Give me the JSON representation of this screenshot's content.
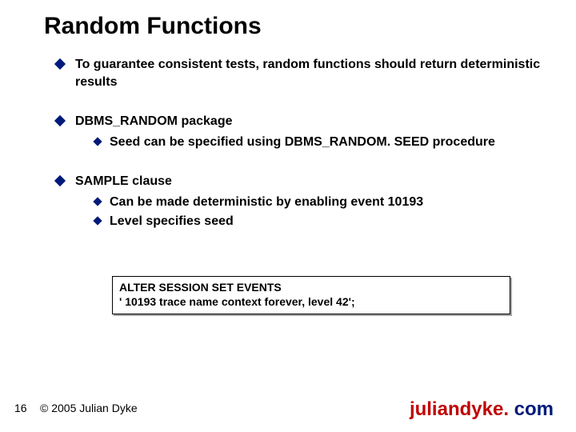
{
  "title": "Random Functions",
  "bullets": {
    "b1": "To guarantee consistent tests, random functions should return deterministic results",
    "b2": "DBMS_RANDOM package",
    "b2s1": "Seed can be specified using DBMS_RANDOM. SEED procedure",
    "b3": "SAMPLE clause",
    "b3s1": "Can be made deterministic by enabling event 10193",
    "b3s2": "Level specifies seed"
  },
  "code": {
    "l1": "ALTER SESSION SET EVENTS",
    "l2": "' 10193 trace name context forever, level 42';"
  },
  "footer": {
    "page": "16",
    "copyright": "© 2005 Julian Dyke",
    "site_name": "juliandyke.",
    "site_tld": " com"
  }
}
